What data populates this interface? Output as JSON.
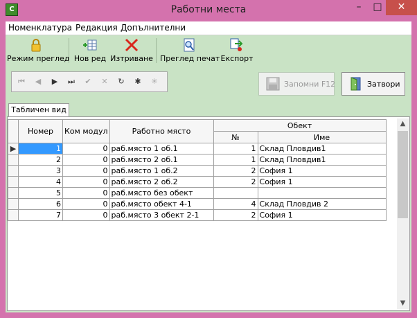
{
  "window": {
    "title": "Работни места",
    "app_icon_label": "C"
  },
  "window_controls": {
    "minimize": "–",
    "maximize": "□",
    "close": "✕"
  },
  "menu": [
    {
      "label": "Номенклатура"
    },
    {
      "label": "Редакция"
    },
    {
      "label": "Допълнителни"
    }
  ],
  "toolbar": [
    {
      "label": "Режим преглед",
      "icon": "lock-icon"
    },
    {
      "label": "Нов ред",
      "icon": "new-row-icon"
    },
    {
      "label": "Изтриване",
      "icon": "delete-x-icon"
    },
    {
      "label": "Преглед печат",
      "icon": "print-preview-icon"
    },
    {
      "label": "Експорт",
      "icon": "export-icon"
    }
  ],
  "navigator": {
    "first": "⏮",
    "prior": "◀",
    "next": "▶",
    "last": "⏭",
    "post": "✔",
    "cancel": "✕",
    "refresh": "↻",
    "insert": "✱",
    "delete": "✳"
  },
  "buttons": {
    "save_label": "Запомни  F12",
    "close_label": "Затвори"
  },
  "tab": {
    "label": "Табличен вид"
  },
  "grid": {
    "headers": {
      "number": "Номер",
      "com_module": "Ком модул",
      "workplace": "Работно място",
      "object_group": "Обект",
      "object_no": "№",
      "object_name": "Име"
    },
    "rows": [
      {
        "number": "1",
        "com_module": "0",
        "workplace": "раб.място 1 об.1",
        "object_no": "1",
        "object_name": "Склад Пловдив1"
      },
      {
        "number": "2",
        "com_module": "0",
        "workplace": "раб.място 2 об.1",
        "object_no": "1",
        "object_name": "Склад Пловдив1"
      },
      {
        "number": "3",
        "com_module": "0",
        "workplace": "раб.място 1 об.2",
        "object_no": "2",
        "object_name": "София 1"
      },
      {
        "number": "4",
        "com_module": "0",
        "workplace": "раб.място 2 об.2",
        "object_no": "2",
        "object_name": "София 1"
      },
      {
        "number": "5",
        "com_module": "0",
        "workplace": "раб.място без обект",
        "object_no": "",
        "object_name": ""
      },
      {
        "number": "6",
        "com_module": "0",
        "workplace": "раб.място обект 4-1",
        "object_no": "4",
        "object_name": "Склад Пловдив 2"
      },
      {
        "number": "7",
        "com_module": "0",
        "workplace": "раб.място 3 обект 2-1",
        "object_no": "2",
        "object_name": "София 1"
      }
    ],
    "current_row_marker": "▶"
  },
  "colors": {
    "frame": "#d472ad",
    "client": "#c9e3c5",
    "selection": "#3399ff",
    "close_button": "#c7504b"
  }
}
